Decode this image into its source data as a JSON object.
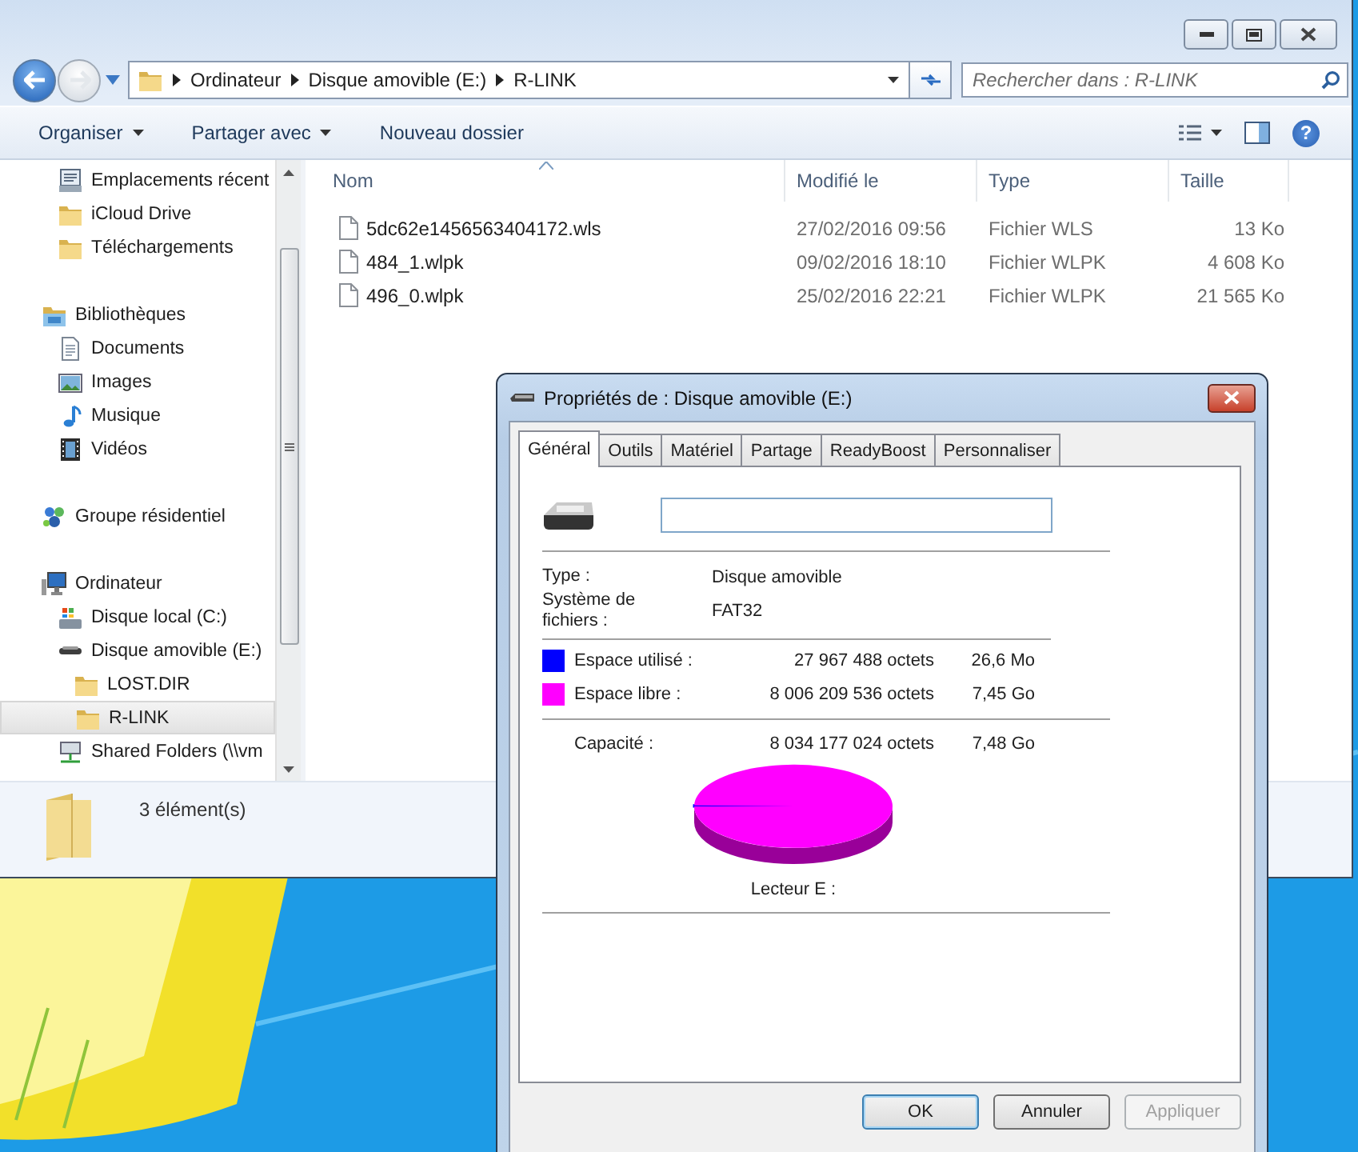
{
  "explorer": {
    "address": [
      "Ordinateur",
      "Disque amovible (E:)",
      "R-LINK"
    ],
    "search_placeholder": "Rechercher dans : R-LINK",
    "help": "?",
    "toolbar": [
      {
        "label": "Organiser",
        "dropdown": true
      },
      {
        "label": "Partager avec",
        "dropdown": true
      },
      {
        "label": "Nouveau dossier",
        "dropdown": false
      }
    ],
    "sidebar": [
      {
        "items": [
          {
            "label": "Emplacements récent",
            "kind": "recent",
            "selected": false
          },
          {
            "label": "iCloud Drive",
            "kind": "folder",
            "selected": false
          },
          {
            "label": "Téléchargements",
            "kind": "folder",
            "selected": false
          }
        ]
      },
      {
        "label": "Bibliothèques",
        "kind": "library",
        "selected": false,
        "items": [
          {
            "label": "Documents",
            "kind": "documents",
            "selected": false
          },
          {
            "label": "Images",
            "kind": "images",
            "selected": false
          },
          {
            "label": "Musique",
            "kind": "music",
            "selected": false
          },
          {
            "label": "Vidéos",
            "kind": "videos",
            "selected": false
          }
        ]
      },
      {
        "label": "Groupe résidentiel",
        "kind": "homegroup",
        "selected": false
      },
      {
        "label": "Ordinateur",
        "kind": "computer",
        "selected": false,
        "items": [
          {
            "label": "Disque local (C:)",
            "kind": "localdisk",
            "selected": false
          },
          {
            "label": "Disque amovible (E:)",
            "kind": "removable",
            "selected": false,
            "children": [
              {
                "label": "LOST.DIR",
                "kind": "folder",
                "selected": false
              },
              {
                "label": "R-LINK",
                "kind": "folder",
                "selected": true
              }
            ]
          },
          {
            "label": "Shared Folders (\\\\vm",
            "kind": "netdrive",
            "selected": false
          }
        ]
      }
    ],
    "columns": [
      {
        "label": "Nom",
        "sorted": true
      },
      {
        "label": "Modifié le",
        "sorted": false
      },
      {
        "label": "Type",
        "sorted": false
      },
      {
        "label": "Taille",
        "sorted": false
      }
    ],
    "files": [
      {
        "name": "5dc62e1456563404172.wls",
        "modified": "27/02/2016 09:56",
        "type": "Fichier WLS",
        "size": "13 Ko"
      },
      {
        "name": "484_1.wlpk",
        "modified": "09/02/2016 18:10",
        "type": "Fichier WLPK",
        "size": "4 608 Ko"
      },
      {
        "name": "496_0.wlpk",
        "modified": "25/02/2016 22:21",
        "type": "Fichier WLPK",
        "size": "21 565 Ko"
      }
    ],
    "status": "3 élément(s)"
  },
  "dialog": {
    "title": "Propriétés de : Disque amovible (E:)",
    "tabs": [
      {
        "label": "Général",
        "selected": true
      },
      {
        "label": "Outils",
        "selected": false
      },
      {
        "label": "Matériel",
        "selected": false
      },
      {
        "label": "Partage",
        "selected": false
      },
      {
        "label": "ReadyBoost",
        "selected": false
      },
      {
        "label": "Personnaliser",
        "selected": false
      }
    ],
    "type": {
      "label": "Type :",
      "value": "Disque amovible"
    },
    "filesystem": {
      "label": "Système de fichiers :",
      "value": "FAT32"
    },
    "space": [
      {
        "label": "Espace utilisé :",
        "bytes": "27 967 488 octets",
        "size": "26,6 Mo",
        "color": "#0000ff"
      },
      {
        "label": "Espace libre :",
        "bytes": "8 006 209 536 octets",
        "size": "7,45 Go",
        "color": "#ff00ff"
      }
    ],
    "capacity": {
      "label": "Capacité :",
      "bytes": "8 034 177 024 octets",
      "size": "7,48 Go"
    },
    "drive_caption": "Lecteur E :",
    "buttons": [
      {
        "label": "OK",
        "default": true,
        "disabled": false
      },
      {
        "label": "Annuler",
        "default": false,
        "disabled": false
      },
      {
        "label": "Appliquer",
        "default": false,
        "disabled": true
      }
    ]
  }
}
